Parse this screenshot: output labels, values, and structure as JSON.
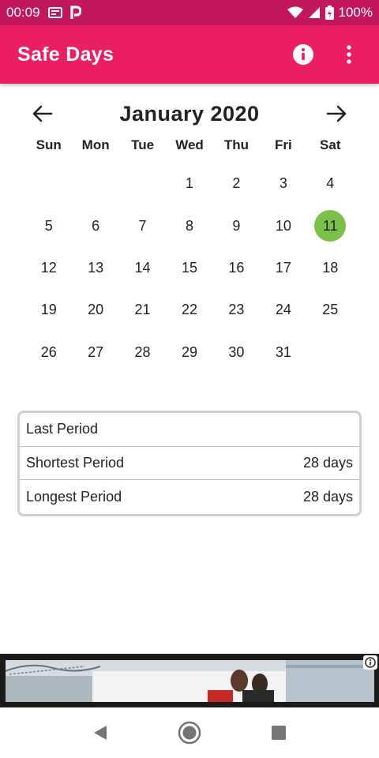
{
  "status_bar": {
    "time": "00:09",
    "battery": "100%",
    "icons": [
      "notification-icon",
      "parking-app-icon",
      "wifi-icon",
      "cell-signal-icon",
      "battery-icon"
    ]
  },
  "app_bar": {
    "title": "Safe Days",
    "info_icon": "info-icon",
    "menu_icon": "more-vert-icon",
    "color": "#e91e63",
    "status_color": "#c2185b"
  },
  "calendar": {
    "month_title": "January 2020",
    "prev_icon": "arrow-left-icon",
    "next_icon": "arrow-right-icon",
    "weekdays": [
      "Sun",
      "Mon",
      "Tue",
      "Wed",
      "Thu",
      "Fri",
      "Sat"
    ],
    "leading_blanks": 3,
    "days": [
      "1",
      "2",
      "3",
      "4",
      "5",
      "6",
      "7",
      "8",
      "9",
      "10",
      "11",
      "12",
      "13",
      "14",
      "15",
      "16",
      "17",
      "18",
      "19",
      "20",
      "21",
      "22",
      "23",
      "24",
      "25",
      "26",
      "27",
      "28",
      "29",
      "30",
      "31"
    ],
    "selected_day": "11",
    "selected_color": "#7cc04b"
  },
  "period_info": {
    "rows": [
      {
        "label": "Last Period",
        "value": ""
      },
      {
        "label": "Shortest Period",
        "value": "28 days"
      },
      {
        "label": "Longest Period",
        "value": "28 days"
      }
    ]
  },
  "ad": {
    "info_icon": "ad-info-icon"
  },
  "nav_bar": {
    "icons": [
      "back-icon",
      "home-icon",
      "recents-icon"
    ]
  }
}
